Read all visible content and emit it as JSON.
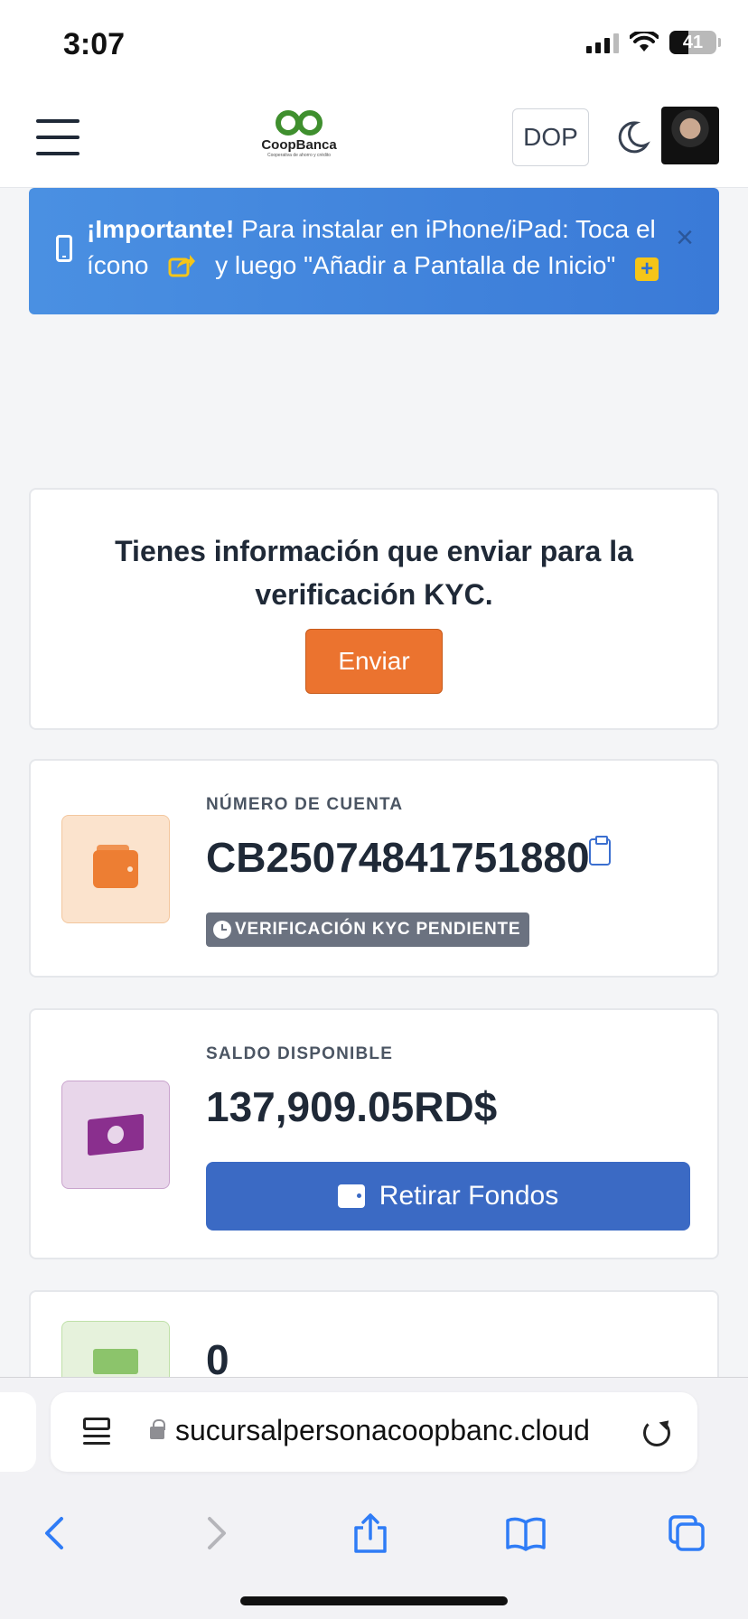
{
  "status_bar": {
    "time": "3:07",
    "battery": "41",
    "battery_level": 0.41
  },
  "header": {
    "logo_name": "CoopBanca",
    "logo_tagline": "Cooperativa de ahorro y crédito",
    "currency": "DOP"
  },
  "alert": {
    "strong": "¡Importante!",
    "line1": " Para instalar en iPhone/iPad: Toca el",
    "line2_a": "ícono",
    "line2_b": "y luego \"Añadir a Pantalla de Inicio\"",
    "close": "×",
    "accent_color": "#4a90e2"
  },
  "kyc_card": {
    "message": "Tienes información que enviar para la verificación KYC.",
    "button": "Enviar"
  },
  "account_card": {
    "label": "NÚMERO DE CUENTA",
    "number": "CB25074841751880",
    "badge": "VERIFICACIÓN KYC PENDIENTE"
  },
  "balance_card": {
    "label": "SALDO DISPONIBLE",
    "value": "137,909.05RD$",
    "button": "Retirar Fondos"
  },
  "third_card": {
    "value": "0"
  },
  "browser": {
    "url": "sucursalpersonacoopbanc.cloud"
  }
}
